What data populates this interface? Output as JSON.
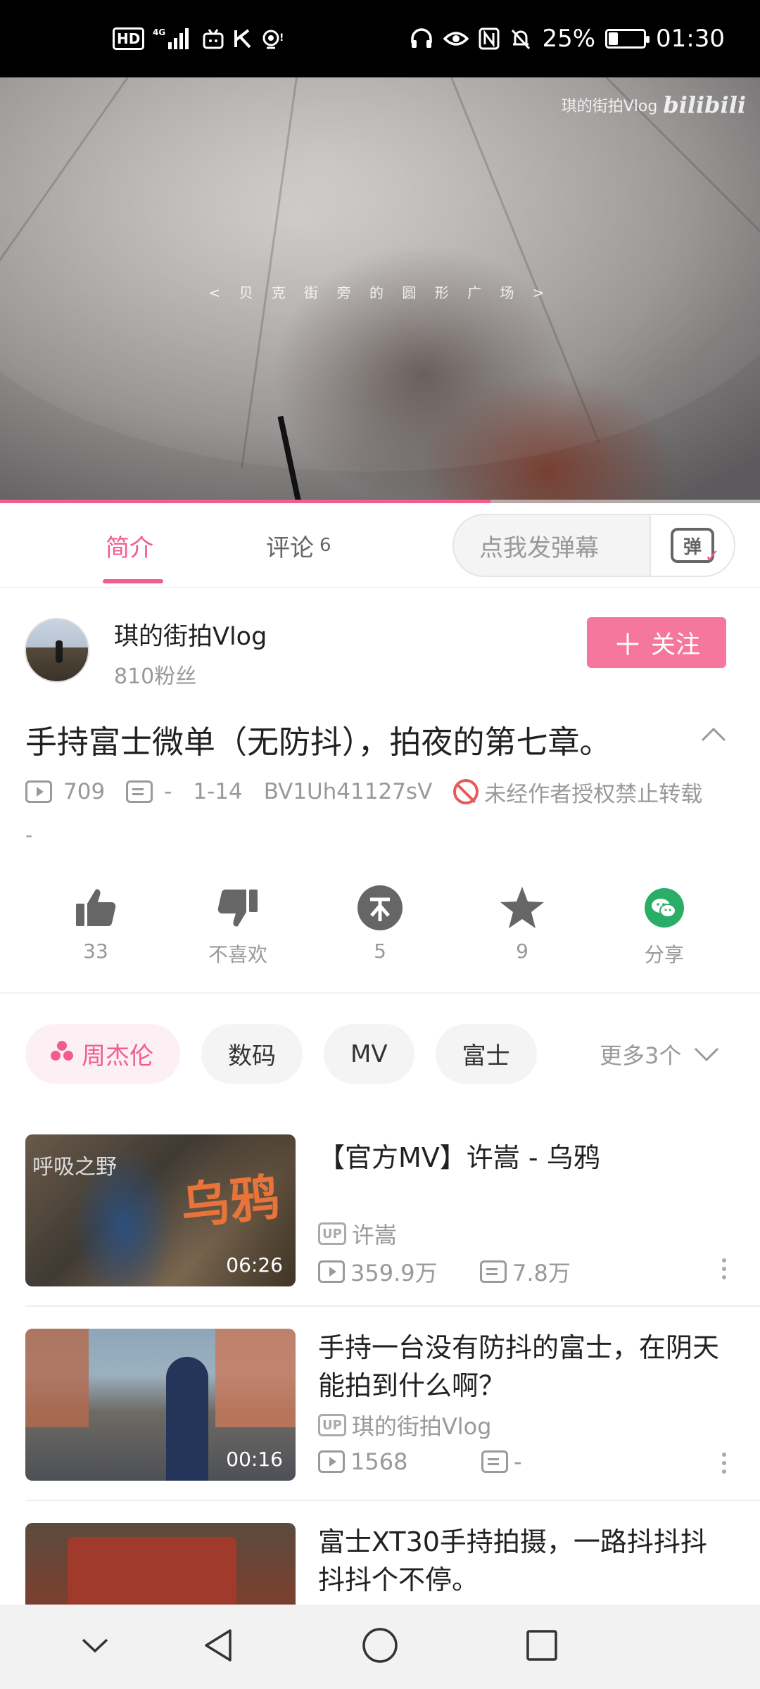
{
  "status_bar": {
    "hd": "HD",
    "network": "4G",
    "battery": "25%",
    "battery_level": 0.25,
    "time": "01:30"
  },
  "video": {
    "watermark_channel": "琪的街拍Vlog",
    "watermark_logo": "bilibili",
    "caption": "< 贝 克 街 旁 的 圆 形 广 场 >",
    "progress": 0.645
  },
  "tabs": {
    "intro": "简介",
    "comments": "评论",
    "comments_count": "6",
    "danmaku_placeholder": "点我发弹幕",
    "danmaku_button": "弹"
  },
  "uploader": {
    "name": "琪的街拍Vlog",
    "fans": "810粉丝",
    "follow_label": "关注"
  },
  "video_info": {
    "title": "手持富士微单（无防抖），拍夜的第七章。",
    "views": "709",
    "danmaku": "-",
    "date": "1-14",
    "bvid": "BV1Uh41127sV",
    "copyright": "未经作者授权禁止转载",
    "desc": "-"
  },
  "actions": {
    "like": "33",
    "dislike": "不喜欢",
    "coin": "5",
    "favorite": "9",
    "share": "分享"
  },
  "tags": {
    "items": [
      "周杰伦",
      "数码",
      "MV",
      "富士"
    ],
    "more": "更多3个"
  },
  "related": [
    {
      "title": "【官方MV】许嵩 - 乌鸦",
      "up": "许嵩",
      "views": "359.9万",
      "danmaku": "7.8万",
      "duration": "06:26",
      "thumb_text": "乌鸦",
      "thumb_side": "呼吸之野"
    },
    {
      "title": "手持一台没有防抖的富士，在阴天能拍到什么啊？",
      "up": "琪的街拍Vlog",
      "views": "1568",
      "danmaku": "-",
      "duration": "00:16"
    },
    {
      "title": "富士XT30手持拍摄，一路抖抖抖抖抖个不停。"
    }
  ],
  "up_badge": "UP",
  "colors": {
    "accent": "#f25d8e",
    "follow_bg": "#f6779d",
    "ban": "#e65a5a",
    "share_green": "#2aae67"
  }
}
